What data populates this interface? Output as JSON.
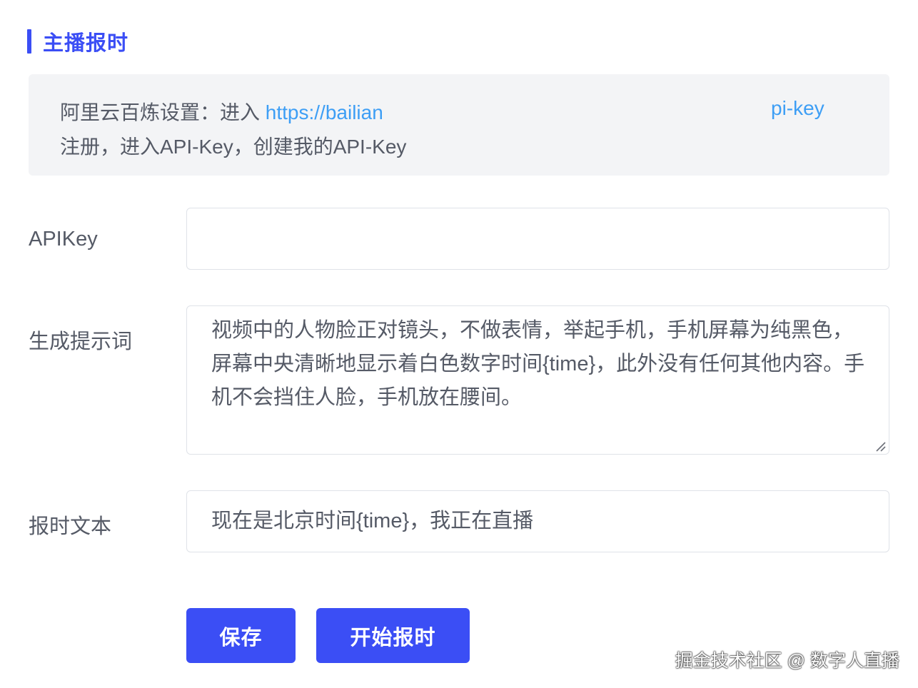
{
  "section": {
    "title": "主播报时"
  },
  "info": {
    "line1_prefix": "阿里云百炼设置：进入 ",
    "link_start": "https://bailian",
    "link_end": "pi-key",
    "line2": "注册，进入API-Key，创建我的API-Key"
  },
  "form": {
    "apikey": {
      "label": "APIKey",
      "value": ""
    },
    "prompt": {
      "label": "生成提示词",
      "value": "视频中的人物脸正对镜头，不做表情，举起手机，手机屏幕为纯黑色，屏幕中央清晰地显示着白色数字时间{time}，此外没有任何其他内容。手机不会挡住人脸，手机放在腰间。"
    },
    "announce_text": {
      "label": "报时文本",
      "value": "现在是北京时间{time}，我正在直播"
    }
  },
  "buttons": {
    "save": "保存",
    "start": "开始报时"
  },
  "watermark": "掘金技术社区 @ 数字人直播",
  "colors": {
    "accent": "#3b4ef5",
    "link": "#3d9ef5",
    "info_bg": "#f3f4f6",
    "text": "#555a66",
    "border": "#dfe2e8"
  }
}
